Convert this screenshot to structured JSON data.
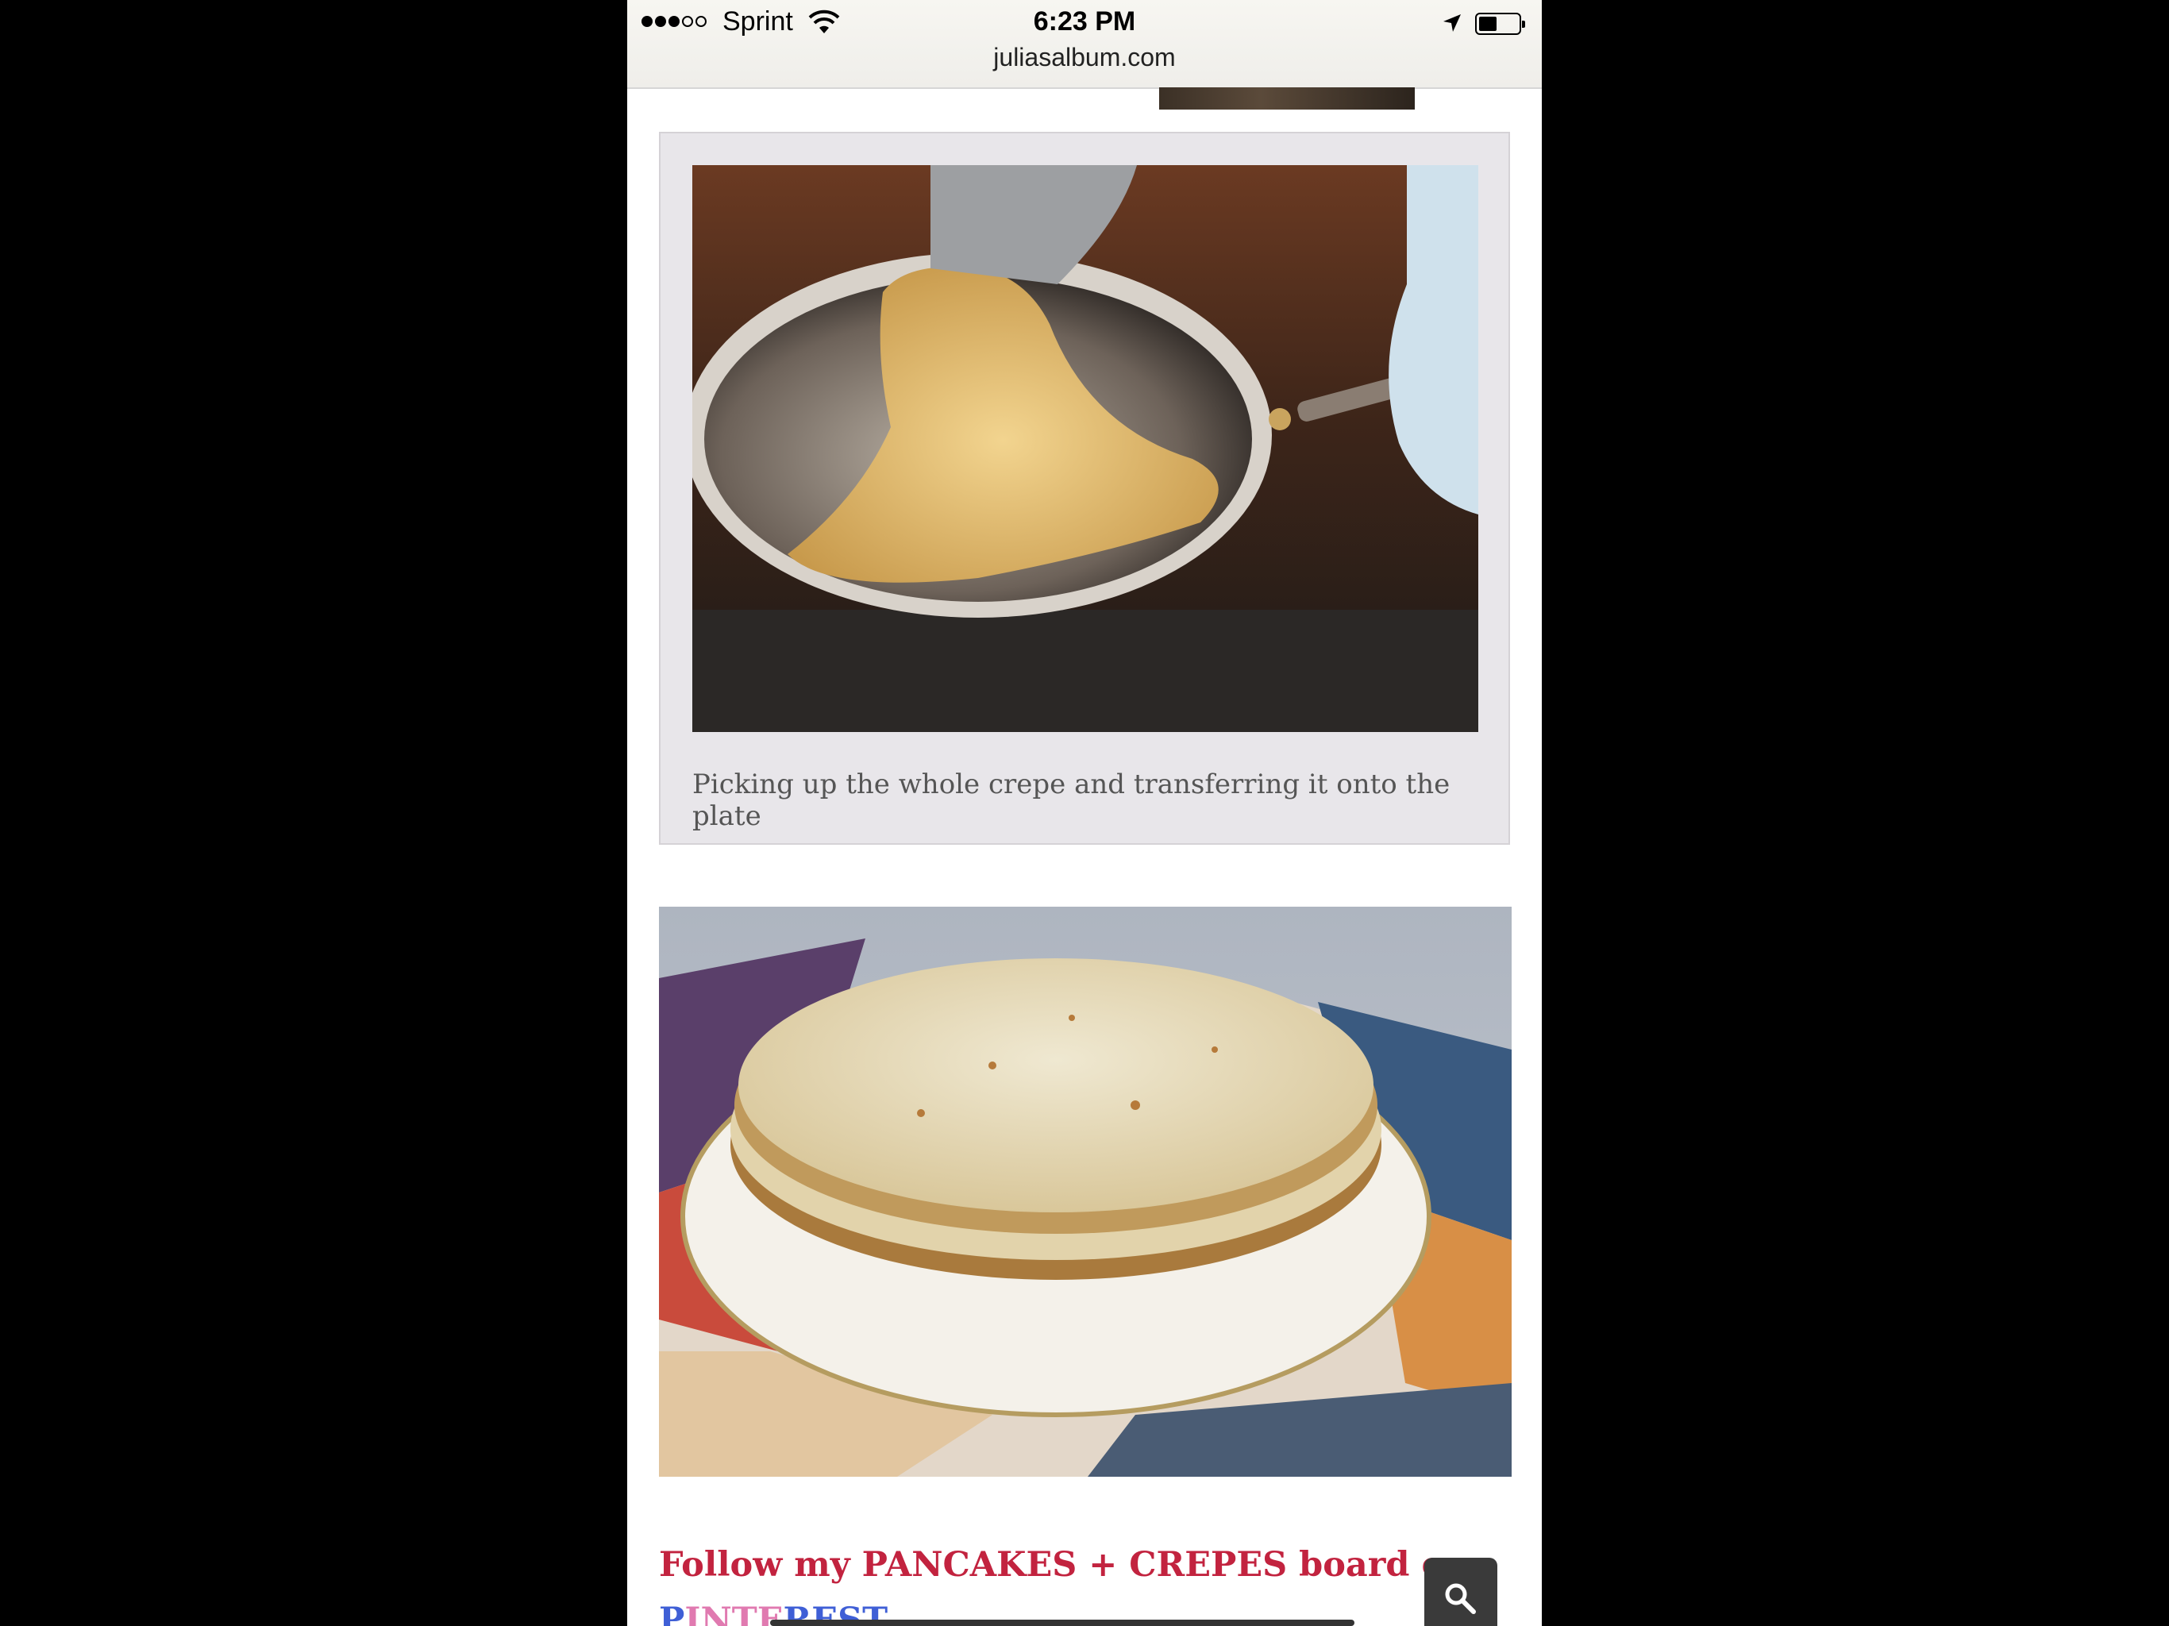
{
  "status_bar": {
    "signal_bars_filled": 3,
    "signal_bars_total": 5,
    "carrier": "Sprint",
    "time": "6:23 PM",
    "url": "juliasalbum.com",
    "icons": [
      "wifi-icon",
      "location-arrow-icon",
      "battery-icon"
    ]
  },
  "article": {
    "photo1_alt": "crepe being lifted from pan with spatula",
    "caption": "Picking up the whole crepe and transferring it onto the plate",
    "photo2_alt": "stack of crepes on a patterned plate",
    "follow_text": "Follow my PANCAKES + CREPES board on",
    "pinterest_parts": [
      "P",
      "INTE",
      "R",
      "EST"
    ]
  },
  "floating": {
    "search_icon": "search-icon"
  }
}
